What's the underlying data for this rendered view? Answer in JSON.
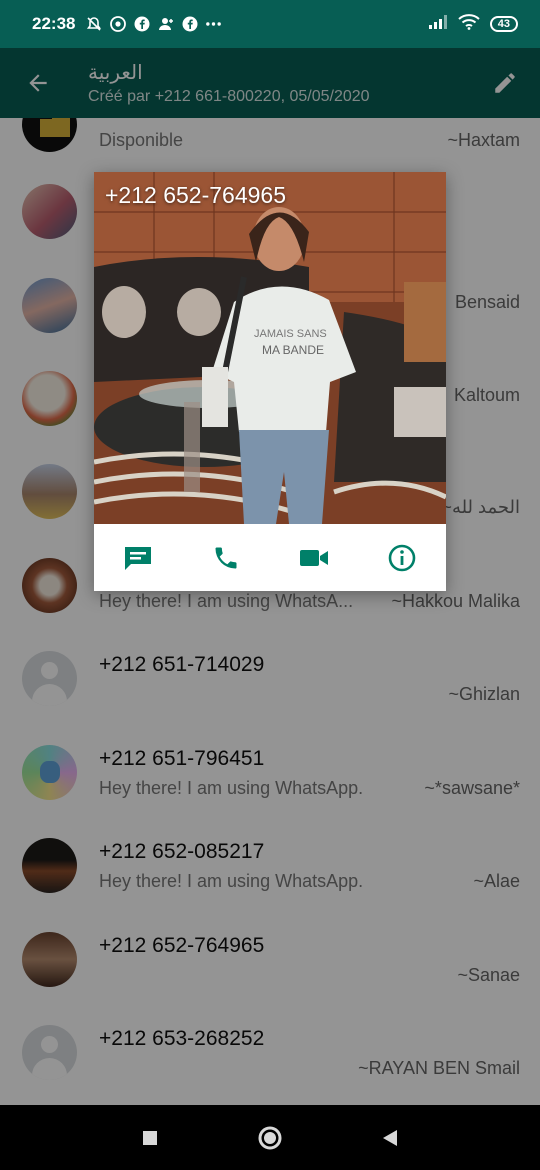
{
  "status_bar": {
    "time": "22:38",
    "battery": "43",
    "icons": [
      "bell-off-icon",
      "chrome-icon",
      "facebook-icon",
      "person-add-icon",
      "facebook-icon",
      "more-icon",
      "signal-icon",
      "wifi-icon",
      "battery-icon"
    ]
  },
  "header": {
    "title": "العربية",
    "subtitle": "Créé par +212 661-800220, 05/05/2020"
  },
  "rows": [
    {
      "name": "",
      "status": "Disponible",
      "alias": "~Haxtam"
    },
    {
      "name": "",
      "status": "",
      "alias": ""
    },
    {
      "name": "",
      "status": "",
      "alias": "Bensaid"
    },
    {
      "name": "",
      "status": "",
      "alias": "Kaltoum"
    },
    {
      "name": "",
      "status": "",
      "alias": "~الحمد لله"
    },
    {
      "name": "",
      "status": "Hey there! I am using WhatsA...",
      "alias": "~Hakkou Malika"
    },
    {
      "name": "+212 651-714029",
      "status": "",
      "alias": "~Ghizlan"
    },
    {
      "name": "+212 651-796451",
      "status": "Hey there! I am using WhatsApp.",
      "alias": "~*sawsane*"
    },
    {
      "name": "+212 652-085217",
      "status": "Hey there! I am using WhatsApp.",
      "alias": "~Alae"
    },
    {
      "name": "+212 652-764965",
      "status": "",
      "alias": "~Sanae"
    },
    {
      "name": "+212 653-268252",
      "status": "",
      "alias": "~RAYAN BEN  Smail"
    }
  ],
  "popup": {
    "title": "+212 652-764965",
    "actions": [
      "message-icon",
      "call-icon",
      "video-call-icon",
      "info-icon"
    ]
  },
  "colors": {
    "header": "#075e54",
    "accent": "#008069"
  }
}
